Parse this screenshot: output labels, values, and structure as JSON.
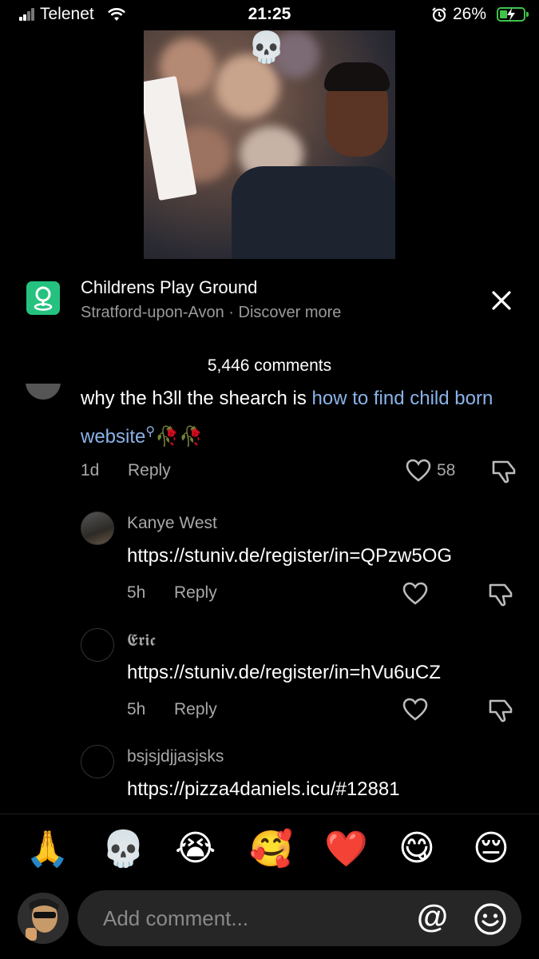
{
  "status_bar": {
    "carrier": "Telenet",
    "time": "21:25",
    "battery_percent": "26%",
    "battery_level": 0.26,
    "charging": true
  },
  "video": {
    "overlay_emoji": "💀"
  },
  "location": {
    "title": "Childrens Play Ground",
    "subtitle": "Stratford-upon-Avon · Discover more",
    "icon": "map-pin-icon",
    "accent": "#25c27f"
  },
  "comments_count": "5,446 comments",
  "comments": [
    {
      "text_plain": "why the h3ll the shearch is ",
      "text_link": "how to find child born website",
      "emoji_tail": "🥀🥀",
      "time": "1d",
      "reply_label": "Reply",
      "likes": "58"
    }
  ],
  "replies": [
    {
      "username": "Kanye West",
      "text": "https://stuniv.de/register/in=QPzw5OG",
      "time": "5h",
      "reply_label": "Reply"
    },
    {
      "username": "𝕰𝖗𝖎𝖈",
      "text": "https://stuniv.de/register/in=hVu6uCZ",
      "time": "5h",
      "reply_label": "Reply"
    },
    {
      "username": "bsjsjdjjasjsks",
      "text": "https://pizza4daniels.icu/#12881"
    }
  ],
  "quick_emojis": [
    "🙏",
    "💀",
    "😭",
    "🥰",
    "❤️",
    "😋",
    "😔"
  ],
  "input": {
    "placeholder": "Add comment...",
    "at_label": "@"
  }
}
